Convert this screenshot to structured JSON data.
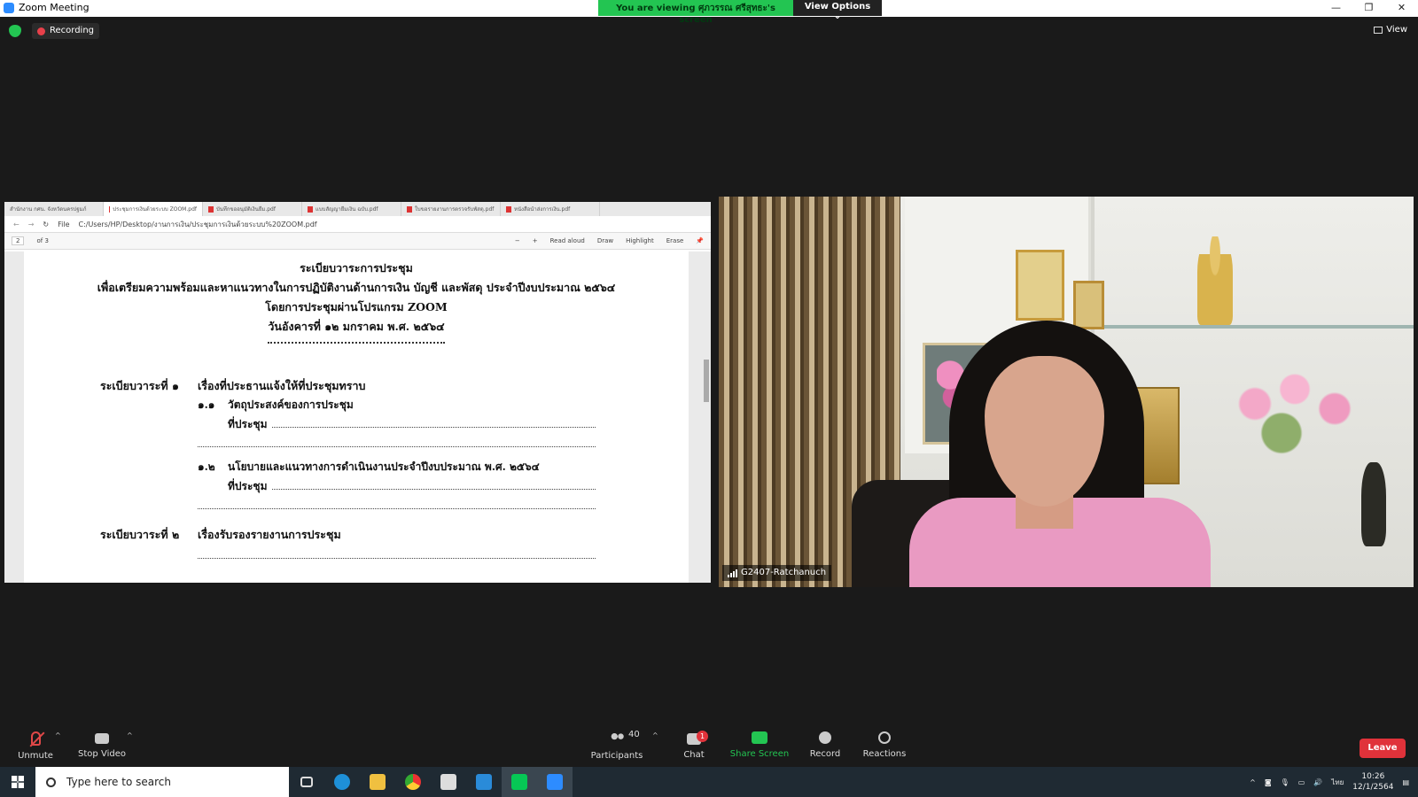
{
  "titlebar": {
    "app_title": "Zoom Meeting",
    "viewing_text": "You are viewing ศุภวรรณ ศรีสุทธะ's screen",
    "view_options": "View Options",
    "window_controls": [
      "—",
      "❐",
      "✕"
    ]
  },
  "status": {
    "recording": "Recording",
    "view": "View"
  },
  "shared_screen": {
    "tabs": [
      {
        "label": "สำนักงาน กศน. จังหวัดนครปฐมภ์"
      },
      {
        "label": "ประชุมการเงินด้วยระบบ ZOOM.pdf"
      },
      {
        "label": "บันทึกขออนุมัติเงินยืม.pdf"
      },
      {
        "label": "แบบสัญญายืมเงิน ฉบับ.pdf"
      },
      {
        "label": "ใบขอรายงานการตรวจรับพัสดุ.pdf"
      },
      {
        "label": "หนังสือนำส่งการเงิน.pdf"
      }
    ],
    "address": {
      "file_label": "File",
      "url": "C:/Users/HP/Desktop/งานการเงิน/ประชุมการเงินด้วยระบบ%20ZOOM.pdf"
    },
    "pdf_toolbar": {
      "page_current": "2",
      "page_total": "of 3",
      "read_aloud": "Read aloud",
      "draw": "Draw",
      "highlight": "Highlight",
      "erase": "Erase"
    },
    "document": {
      "title_lines": [
        "ระเบียบวาระการประชุม",
        "เพื่อเตรียมความพร้อมและหาแนวทางในการปฏิบัติงานด้านการเงิน บัญชี และพัสดุ ประจำปีงบประมาณ ๒๕๖๔",
        "โดยการประชุมผ่านโปรแกรม ZOOM",
        "วันอังคารที่  ๑๒  มกราคม  พ.ศ. ๒๕๖๔"
      ],
      "agenda1_label": "ระเบียบวาระที่ ๑",
      "agenda1_text": "เรื่องที่ประธานแจ้งให้ที่ประชุมทราบ",
      "item11_num": "๑.๑",
      "item11_text": "วัตถุประสงค์ของการประชุม",
      "item11_meeting": "ที่ประชุม",
      "item12_num": "๑.๒",
      "item12_text": "นโยบายและแนวทางการดำเนินงานประจำปีงบประมาณ  พ.ศ. ๒๕๖๔",
      "item12_meeting": "ที่ประชุม",
      "agenda2_label": "ระเบียบวาระที่ ๒",
      "agenda2_text": "เรื่องรับรองรายงานการประชุม"
    }
  },
  "video": {
    "participant_name": "G2407-Ratchanuch"
  },
  "toolbar": {
    "unmute": "Unmute",
    "stop_video": "Stop Video",
    "participants": "Participants",
    "participants_count": "40",
    "chat": "Chat",
    "chat_badge": "1",
    "share_screen": "Share Screen",
    "record": "Record",
    "reactions": "Reactions",
    "leave": "Leave"
  },
  "taskbar": {
    "search_placeholder": "Type here to search",
    "language": "ไทย",
    "time": "10:26",
    "date": "12/1/2564"
  },
  "colors": {
    "zoom_green": "#23c552",
    "leave_red": "#e0323a",
    "zoom_blue": "#2d8cff"
  }
}
